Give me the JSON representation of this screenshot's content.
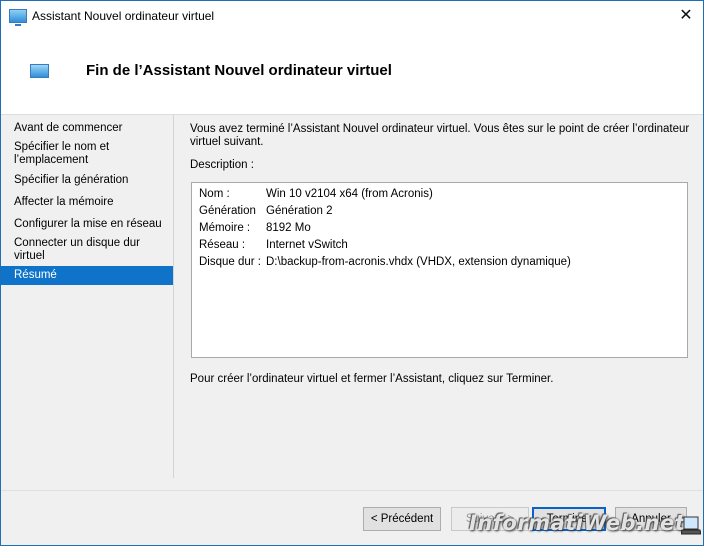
{
  "window": {
    "title": "Assistant Nouvel ordinateur virtuel",
    "close_glyph": "✕"
  },
  "header": {
    "title": "Fin de l’Assistant Nouvel ordinateur virtuel"
  },
  "sidebar": {
    "items": [
      {
        "label": "Avant de commencer"
      },
      {
        "label": "Spécifier le nom et l’emplacement"
      },
      {
        "label": "Spécifier la génération"
      },
      {
        "label": "Affecter la mémoire"
      },
      {
        "label": "Configurer la mise en réseau"
      },
      {
        "label": "Connecter un disque dur virtuel"
      },
      {
        "label": "Résumé",
        "active": true
      }
    ]
  },
  "content": {
    "intro": "Vous avez terminé l’Assistant Nouvel ordinateur virtuel. Vous êtes sur le point de créer l’ordinateur virtuel suivant.",
    "description_label": "Description :",
    "summary": [
      {
        "key": "Nom :",
        "value": "Win 10 v2104 x64 (from Acronis)"
      },
      {
        "key": "Génération",
        "value": "Génération 2"
      },
      {
        "key": "Mémoire :",
        "value": "8192 Mo"
      },
      {
        "key": "Réseau :",
        "value": "Internet vSwitch"
      },
      {
        "key": "Disque dur :",
        "value": "D:\\backup-from-acronis.vhdx (VHDX, extension dynamique)"
      }
    ],
    "finish_note": "Pour créer l’ordinateur virtuel et fermer l’Assistant, cliquez sur Terminer."
  },
  "buttons": {
    "previous": "< Précédent",
    "next": "Suivant >",
    "finish": "Terminer",
    "cancel": "Annuler"
  },
  "watermark": "InformatiWeb.net",
  "colors": {
    "accent": "#0f74c9",
    "window_border": "#1e6fb8"
  },
  "icons": {
    "title": "monitor-icon",
    "header": "monitor-icon",
    "close": "close-icon"
  }
}
